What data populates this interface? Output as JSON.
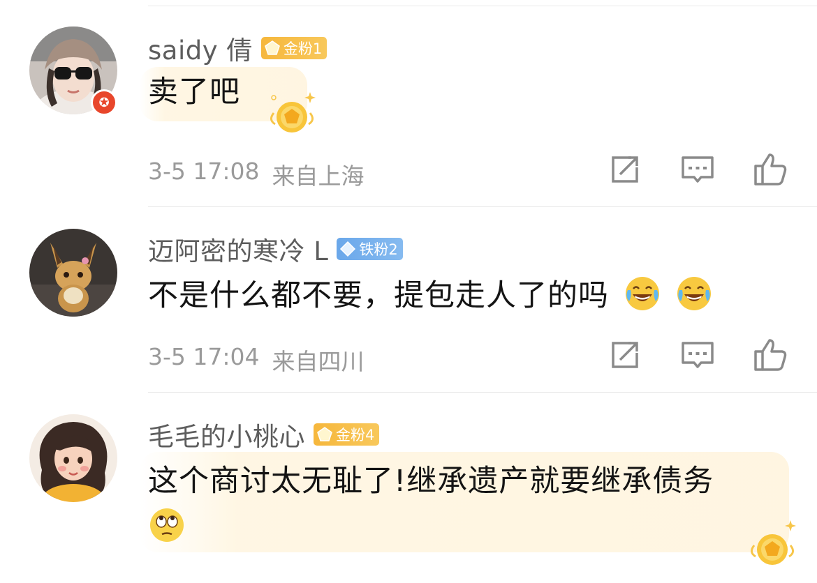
{
  "comments": [
    {
      "username": "saidy 倩",
      "fan_badge": "金粉1",
      "fan_badge_type": "gold",
      "text": "卖了吧",
      "time": "3-5 17:08",
      "location": "来自上海",
      "verified": true
    },
    {
      "username": "迈阿密的寒冷 L",
      "fan_badge": "铁粉2",
      "fan_badge_type": "iron",
      "text": "不是什么都不要，提包走人了的吗",
      "emojis": [
        "laugh-cry-icon",
        "laugh-cry-icon"
      ],
      "time": "3-5 17:04",
      "location": "来自四川",
      "verified": false
    },
    {
      "username": "毛毛的小桃心",
      "fan_badge": "金粉4",
      "fan_badge_type": "gold",
      "text": "这个商讨太无耻了!继承遗产就要继承债务",
      "emojis": [
        "eye-roll-icon"
      ],
      "verified": false
    }
  ],
  "icons": {
    "share": "share-icon",
    "reply": "comment-icon",
    "like": "thumbs-up-icon"
  },
  "colors": {
    "gold_badge": "#f6b73c",
    "iron_badge": "#6aa7ea",
    "verified_red": "#e8462b",
    "meta_gray": "#9a9a9a",
    "username_gray": "#5d5d5d"
  }
}
